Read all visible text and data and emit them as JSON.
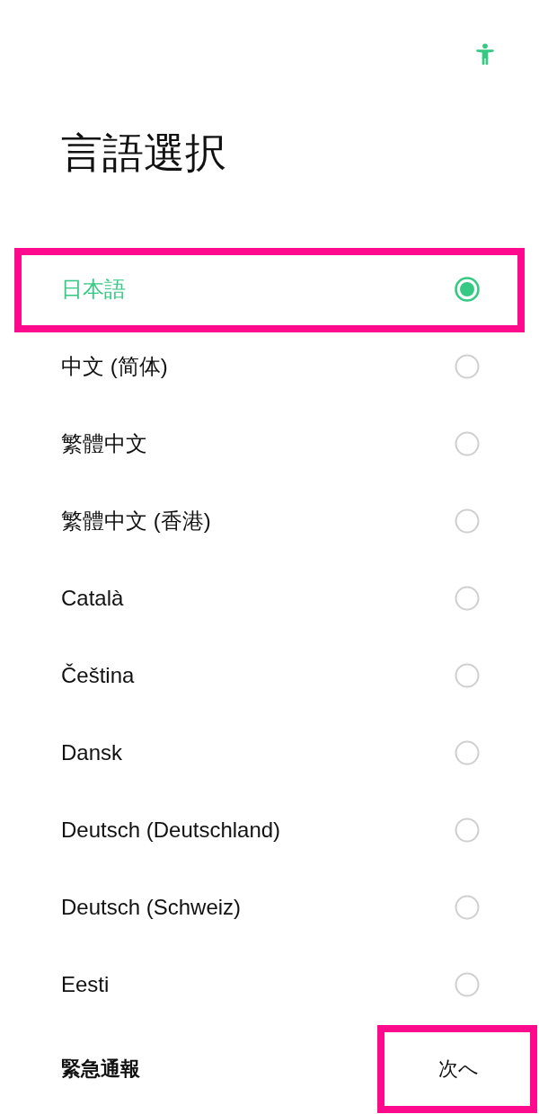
{
  "title": "言語選択",
  "languages": [
    {
      "label": "日本語",
      "selected": true,
      "highlighted": true
    },
    {
      "label": "中文 (简体)",
      "selected": false,
      "highlighted": false
    },
    {
      "label": "繁體中文",
      "selected": false,
      "highlighted": false
    },
    {
      "label": "繁體中文 (香港)",
      "selected": false,
      "highlighted": false
    },
    {
      "label": "Català",
      "selected": false,
      "highlighted": false
    },
    {
      "label": "Čeština",
      "selected": false,
      "highlighted": false
    },
    {
      "label": "Dansk",
      "selected": false,
      "highlighted": false
    },
    {
      "label": "Deutsch (Deutschland)",
      "selected": false,
      "highlighted": false
    },
    {
      "label": "Deutsch (Schweiz)",
      "selected": false,
      "highlighted": false
    },
    {
      "label": "Eesti",
      "selected": false,
      "highlighted": false
    }
  ],
  "footer": {
    "emergency_call": "緊急通報",
    "next_button": {
      "label": "次へ",
      "highlighted": true
    }
  }
}
